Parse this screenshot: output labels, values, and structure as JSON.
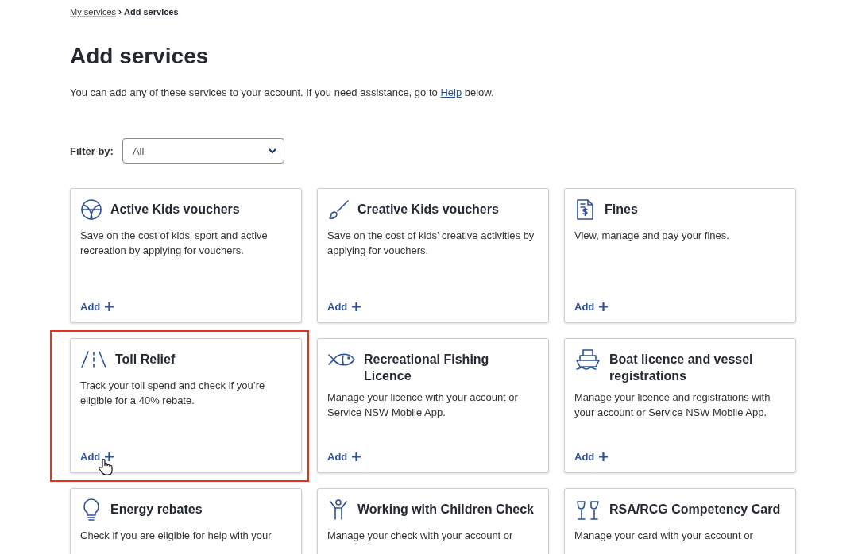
{
  "breadcrumb": {
    "parent": "My services",
    "separator": "›",
    "current": "Add services"
  },
  "title": "Add services",
  "intro": {
    "before": "You can add any of these services to your account. If you need assistance, go to ",
    "link": "Help",
    "after": " below."
  },
  "filter": {
    "label": "Filter by:",
    "value": "All"
  },
  "cards": [
    {
      "title": "Active Kids vouchers",
      "description": "Save on the cost of kids’ sport and active recreation by applying for vouchers.",
      "action": "Add",
      "highlighted": false
    },
    {
      "title": "Creative Kids vouchers",
      "description": "Save on the cost of kids’ creative activities by applying for vouchers.",
      "action": "Add",
      "highlighted": false
    },
    {
      "title": "Fines",
      "description": "View, manage and pay your fines.",
      "action": "Add",
      "highlighted": false
    },
    {
      "title": "Toll Relief",
      "description": "Track your toll spend and check if you’re eligible for a 40% rebate.",
      "action": "Add",
      "highlighted": true
    },
    {
      "title": "Recreational Fishing Licence",
      "description": "Manage your licence with your account or Service NSW Mobile App.",
      "action": "Add",
      "highlighted": false
    },
    {
      "title": "Boat licence and vessel registrations",
      "description": "Manage your licence and registrations with your account or Service NSW Mobile App.",
      "action": "Add",
      "highlighted": false
    },
    {
      "title": "Energy rebates",
      "description": "Check if you are eligible for help with your",
      "highlighted": false
    },
    {
      "title": "Working with Children Check",
      "description": "Manage your check with your account or",
      "highlighted": false
    },
    {
      "title": "RSA/RCG Competency Card",
      "description": "Manage your card with your account or",
      "highlighted": false
    }
  ]
}
